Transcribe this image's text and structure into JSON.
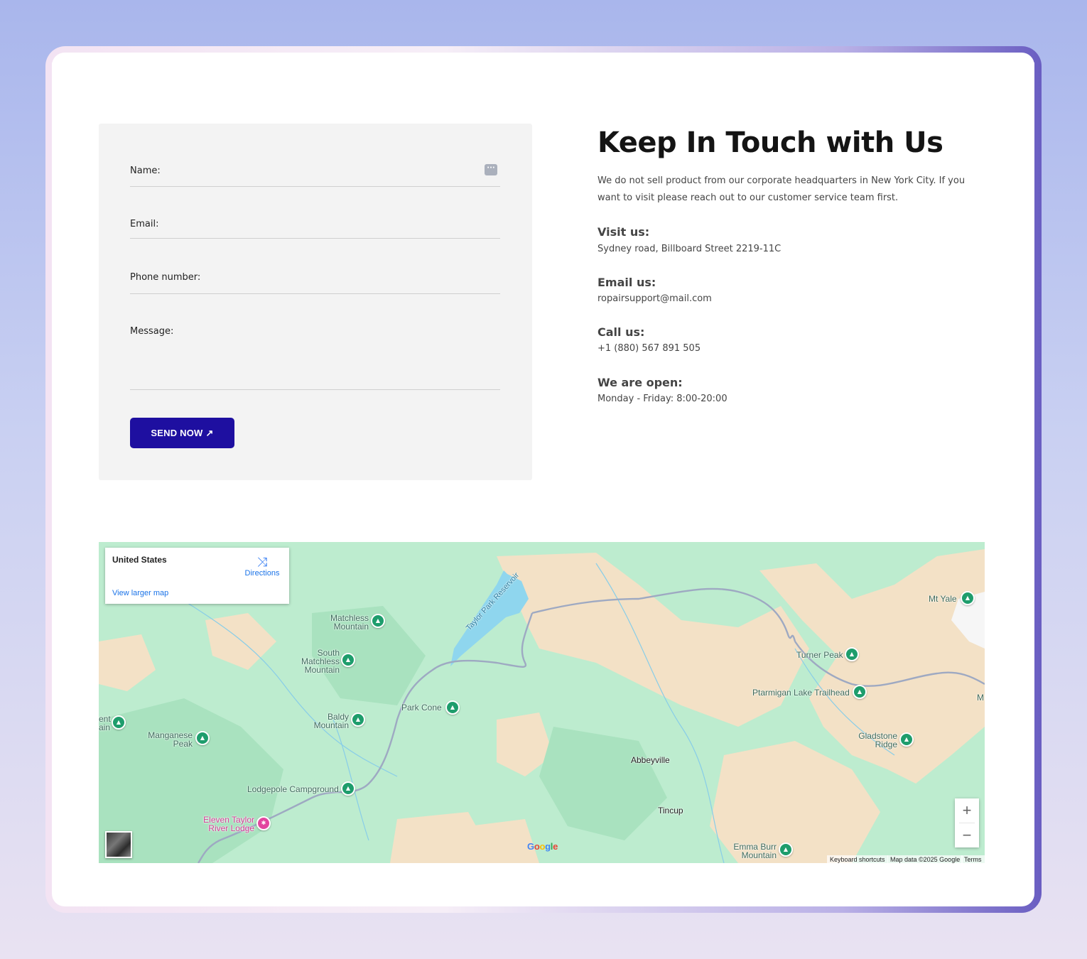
{
  "form": {
    "name_label": "Name:",
    "email_label": "Email:",
    "phone_label": "Phone number:",
    "message_label": "Message:",
    "submit_label": "SEND NOW",
    "submit_icon": "arrow-up-right-icon"
  },
  "contact": {
    "title": "Keep In Touch with Us",
    "intro": "We do not sell product from our corporate headquarters in New York City. If you want to visit please reach out to our customer service team first.",
    "visit_heading": "Visit us:",
    "visit_value": "Sydney road, Billboard Street 2219-11C",
    "email_heading": "Email us:",
    "email_value": "ropairsupport@mail.com",
    "call_heading": "Call us:",
    "call_value": "+1 (880) 567 891 505",
    "open_heading": "We are open:",
    "open_value": "Monday - Friday: 8:00-20:00"
  },
  "map": {
    "place_name": "United States",
    "directions_label": "Directions",
    "view_larger_label": "View larger map",
    "reservoir": "Taylor Park Reservoir",
    "peaks": {
      "matchless": [
        "Matchless",
        "Mountain"
      ],
      "south_matchless": [
        "South",
        "Matchless",
        "Mountain"
      ],
      "park_cone": "Park Cone",
      "baldy": [
        "Baldy",
        "Mountain"
      ],
      "manganese": [
        "Manganese",
        "Peak"
      ],
      "lodgepole": "Lodgepole Campground",
      "eleven_taylor": [
        "Eleven Taylor",
        "River Lodge"
      ],
      "mt_yale": "Mt Yale",
      "turner_peak": "Turner Peak",
      "ptarmigan": "Ptarmigan Lake Trailhead",
      "gladstone": [
        "Gladstone",
        "Ridge"
      ],
      "emma_burr": [
        "Emma Burr",
        "Mountain"
      ],
      "left_edge": [
        "ent",
        "ain"
      ],
      "right_edge": "M"
    },
    "towns": {
      "abbeyville": "Abbeyville",
      "tincup": "Tincup"
    },
    "zoom_in": "+",
    "zoom_out": "−",
    "google_logo": "Google",
    "attribution": {
      "shortcuts": "Keyboard shortcuts",
      "map_data": "Map data ©2025 Google",
      "terms": "Terms"
    }
  },
  "colors": {
    "accent": "#1e0fa0",
    "map_green": "#bdeccf",
    "map_tan": "#f3e1c6",
    "water": "#8fd6ee",
    "pin_green": "#1e9d6c",
    "pin_pink": "#e2459f"
  }
}
